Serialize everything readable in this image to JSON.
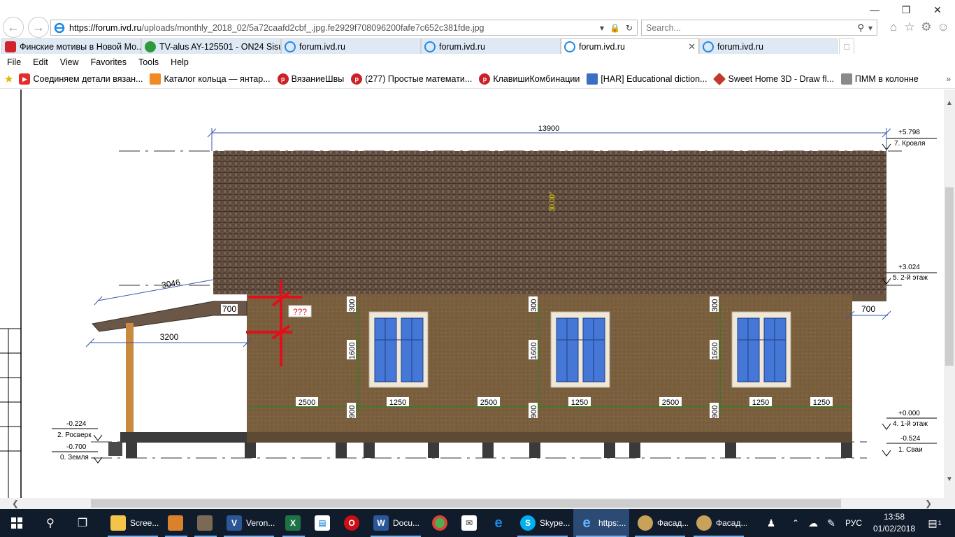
{
  "browser": {
    "address": {
      "host": "https://forum.ivd.ru",
      "path": "/uploads/monthly_2018_02/5a72caafd2cbf_.jpg.fe2929f708096200fafe7c652c381fde.jpg"
    },
    "search": {
      "placeholder": "Search..."
    },
    "tabs": [
      {
        "label": "Финские мотивы в Новой Мо...",
        "icon": "red-news-icon",
        "active": false
      },
      {
        "label": "TV-alus AY-125501 - ON24 Sisu...",
        "icon": "green-globe-icon",
        "active": false
      },
      {
        "label": "forum.ivd.ru",
        "icon": "ie-page-icon",
        "active": false
      },
      {
        "label": "forum.ivd.ru",
        "icon": "ie-page-icon",
        "active": false
      },
      {
        "label": "forum.ivd.ru",
        "icon": "ie-page-icon",
        "active": true
      },
      {
        "label": "forum.ivd.ru",
        "icon": "ie-page-icon",
        "active": false
      }
    ],
    "menu": [
      "File",
      "Edit",
      "View",
      "Favorites",
      "Tools",
      "Help"
    ],
    "favorites": [
      {
        "label": "Соединяем детали вязан...",
        "icon": "youtube-icon",
        "color": "#e52d27"
      },
      {
        "label": "Каталог кольца — янтар...",
        "icon": "orange-shop-icon",
        "color": "#f08a24"
      },
      {
        "label": "ВязаниеШвы",
        "icon": "pinterest-icon",
        "color": "#cb2027"
      },
      {
        "label": "(277) Простые математи...",
        "icon": "pinterest-icon",
        "color": "#cb2027"
      },
      {
        "label": "КлавишиКомбинации",
        "icon": "pinterest-icon",
        "color": "#cb2027"
      },
      {
        "label": "[HAR] Educational diction...",
        "icon": "flag-icon",
        "color": "#3a6fc4"
      },
      {
        "label": "Sweet Home 3D - Draw fl...",
        "icon": "sweethome-icon",
        "color": "#c0392b"
      },
      {
        "label": "ПММ в колонне",
        "icon": "gear-image-icon",
        "color": "#8a8a8a"
      }
    ]
  },
  "drawing": {
    "dims": {
      "overall": "13900",
      "porch_slope": "3046",
      "porch_width": "3200",
      "overhang_left": "700",
      "overhang_right": "700",
      "roof_pitch": "30.00°",
      "question": "???",
      "sill_height": "900",
      "window_height": "1600",
      "lintel": "300",
      "spacing_a": "2500",
      "window_width": "1250"
    },
    "levels": [
      {
        "value": "+5.798",
        "name": "7. Кровля"
      },
      {
        "value": "+3.024",
        "name": "5. 2-й этаж"
      },
      {
        "value": "+0.000",
        "name": "4. 1-й этаж"
      },
      {
        "value": "-0.524",
        "name": "1. Сваи"
      },
      {
        "value": "-0.224",
        "name": "2. Росверк"
      },
      {
        "value": "-0.700",
        "name": "0. Земля"
      }
    ]
  },
  "taskbar": {
    "items": [
      {
        "label": "Scree...",
        "icon": "folder-icon",
        "color": "#f3c34a"
      },
      {
        "label": "",
        "icon": "paint-icon",
        "color": "#d9822b"
      },
      {
        "label": "",
        "icon": "tools-icon",
        "color": "#7a6a55"
      },
      {
        "label": "Veron...",
        "icon": "viber-doc-icon",
        "color": "#2b5797"
      },
      {
        "label": "",
        "icon": "excel-icon",
        "color": "#1f7244"
      },
      {
        "label": "",
        "icon": "store-icon",
        "color": "#ffffff"
      },
      {
        "label": "",
        "icon": "opera-icon",
        "color": "#cc0f16"
      },
      {
        "label": "Docu...",
        "icon": "word-icon",
        "color": "#2b579a"
      },
      {
        "label": "",
        "icon": "chrome-icon",
        "color": "#4caf50"
      },
      {
        "label": "",
        "icon": "mail-icon",
        "color": "#ffffff"
      },
      {
        "label": "",
        "icon": "edge-icon",
        "color": "#1e88e5"
      },
      {
        "label": "Skype...",
        "icon": "skype-icon",
        "color": "#00aff0"
      },
      {
        "label": "https:...",
        "icon": "ie-icon",
        "color": "#1e88e5"
      },
      {
        "label": "Фасад...",
        "icon": "paint-palette-icon",
        "color": "#c9a25a"
      },
      {
        "label": "Фасад...",
        "icon": "paint-palette-icon",
        "color": "#c9a25a"
      }
    ],
    "language": "РУС",
    "time": "13:58",
    "date": "01/02/2018",
    "notification_count": "1"
  }
}
